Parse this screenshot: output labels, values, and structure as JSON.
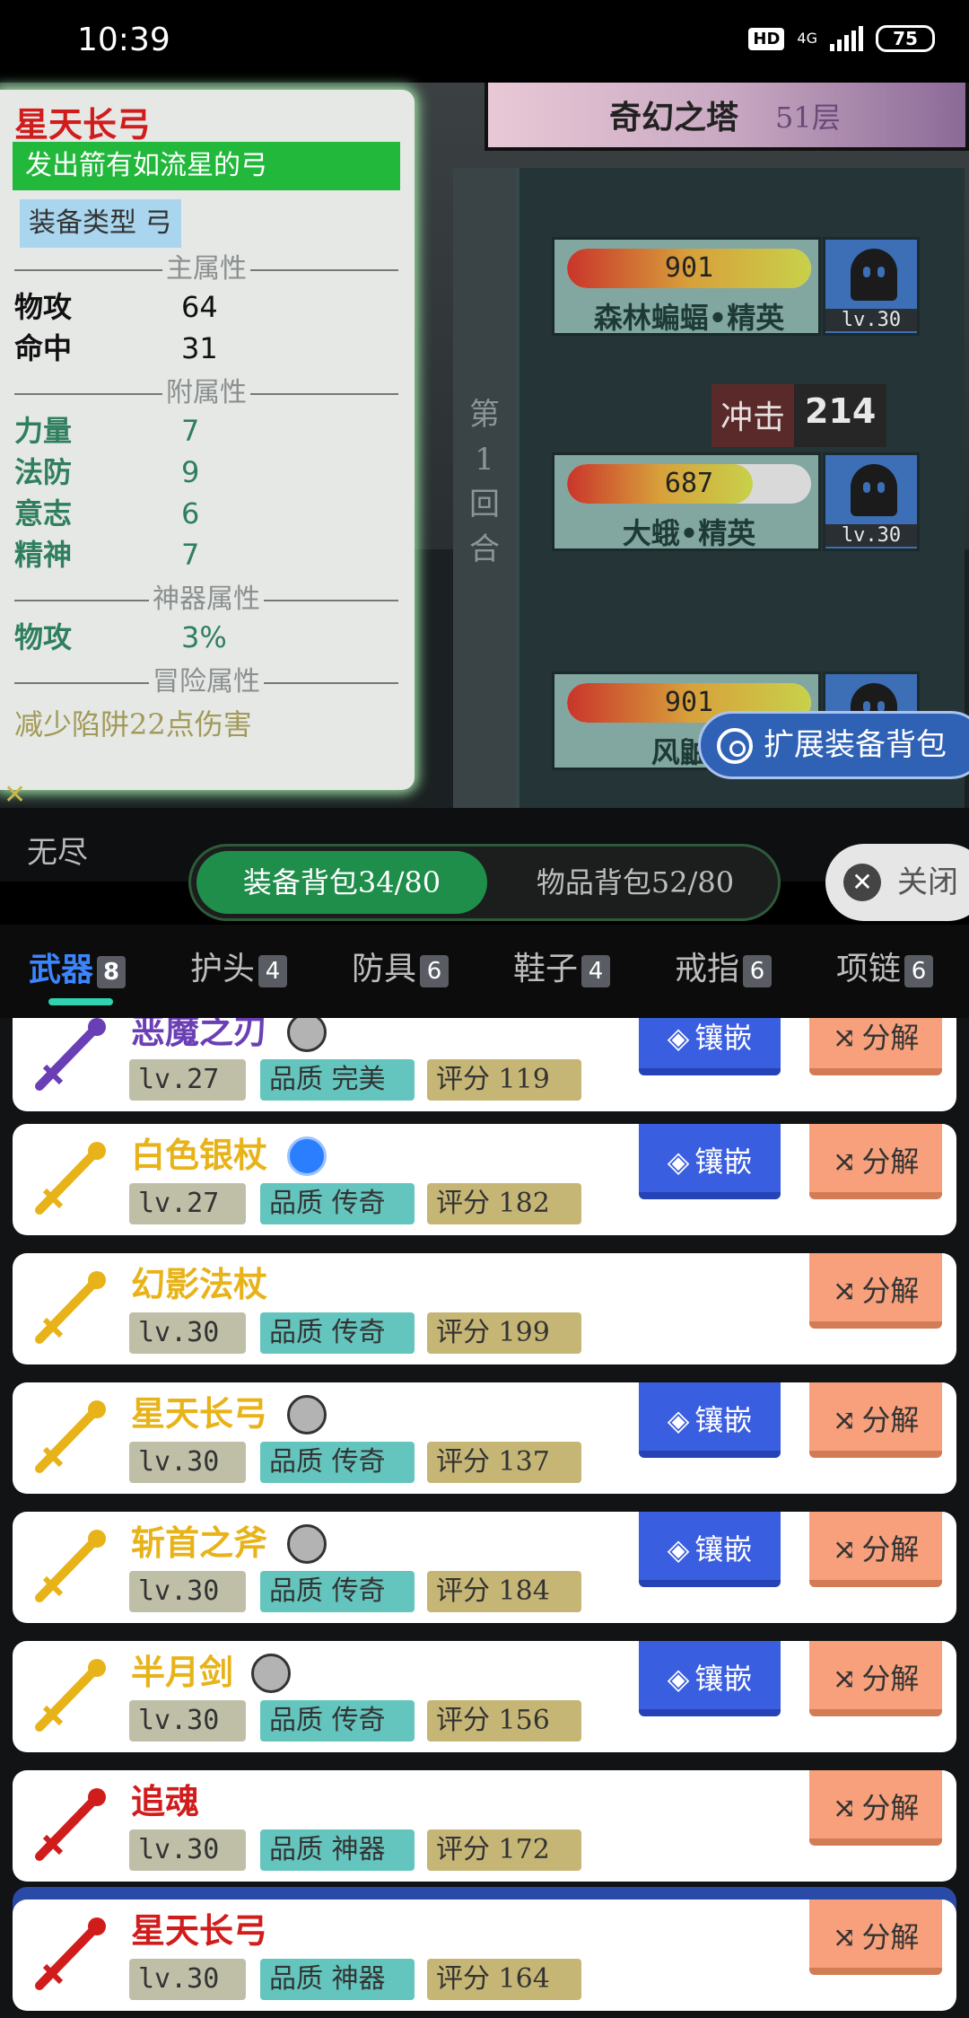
{
  "status_bar": {
    "time": "10:39",
    "hd": "HD",
    "network": "4G",
    "battery": "75"
  },
  "scene": {
    "tower_title": "奇幻之塔",
    "tower_floor": "51层",
    "round_text": "第1回合",
    "impact_label": "冲击",
    "impact_value": "214",
    "expand_bag_label": "扩展装备背包",
    "strip_text": "无尽",
    "enemies": [
      {
        "hp": "901",
        "hp_fraction": 1.0,
        "name": "森林蝙蝠•精英",
        "level": "lv.30"
      },
      {
        "hp": "687",
        "hp_fraction": 0.76,
        "name": "大蛾•精英",
        "level": "lv.30"
      },
      {
        "hp": "901",
        "hp_fraction": 1.0,
        "name": "风鼬•",
        "level": ""
      }
    ]
  },
  "detail": {
    "name": "星天长弓",
    "desc": "发出箭有如流星的弓",
    "type": "装备类型 弓",
    "main_title": "主属性",
    "main_attrs": [
      {
        "k": "物攻",
        "v": "64"
      },
      {
        "k": "命中",
        "v": "31"
      }
    ],
    "sub_title": "附属性",
    "sub_attrs": [
      {
        "k": "力量",
        "v": "7"
      },
      {
        "k": "法防",
        "v": "9"
      },
      {
        "k": "意志",
        "v": "6"
      },
      {
        "k": "精神",
        "v": "7"
      }
    ],
    "artifact_title": "神器属性",
    "artifact_attrs": [
      {
        "k": "物攻",
        "v": "3%"
      }
    ],
    "adventure_title": "冒险属性",
    "adventure_text": "减少陷阱22点伤害"
  },
  "bag": {
    "equip_tab": "装备背包34/80",
    "item_tab": "物品背包52/80",
    "close_label": "关闭"
  },
  "categories": [
    {
      "label": "武器",
      "count": "8"
    },
    {
      "label": "护头",
      "count": "4"
    },
    {
      "label": "防具",
      "count": "6"
    },
    {
      "label": "鞋子",
      "count": "4"
    },
    {
      "label": "戒指",
      "count": "6"
    },
    {
      "label": "项链",
      "count": "6"
    }
  ],
  "buttons": {
    "inlay": "镶嵌",
    "decompose": "分解"
  },
  "items": [
    {
      "name": "恶魔之刃",
      "color": "#6a3fb5",
      "gem": "empty",
      "level": "lv.27",
      "quality": "品质 完美",
      "score": "评分 119",
      "inlay": true
    },
    {
      "name": "白色银杖",
      "color": "#e8b318",
      "gem": "blue",
      "level": "lv.27",
      "quality": "品质 传奇",
      "score": "评分 182",
      "inlay": true
    },
    {
      "name": "幻影法杖",
      "color": "#e8b318",
      "gem": "none",
      "level": "lv.30",
      "quality": "品质 传奇",
      "score": "评分 199",
      "inlay": false
    },
    {
      "name": "星天长弓",
      "color": "#e8b318",
      "gem": "empty",
      "level": "lv.30",
      "quality": "品质 传奇",
      "score": "评分 137",
      "inlay": true
    },
    {
      "name": "斩首之斧",
      "color": "#e8b318",
      "gem": "empty",
      "level": "lv.30",
      "quality": "品质 传奇",
      "score": "评分 184",
      "inlay": true
    },
    {
      "name": "半月剑",
      "color": "#e8b318",
      "gem": "empty",
      "level": "lv.30",
      "quality": "品质 传奇",
      "score": "评分 156",
      "inlay": true
    },
    {
      "name": "追魂",
      "color": "#d11c1c",
      "gem": "none",
      "level": "lv.30",
      "quality": "品质 神器",
      "score": "评分 172",
      "inlay": false
    },
    {
      "name": "星天长弓",
      "color": "#d11c1c",
      "gem": "none",
      "level": "lv.30",
      "quality": "品质 神器",
      "score": "评分 164",
      "inlay": false
    }
  ]
}
